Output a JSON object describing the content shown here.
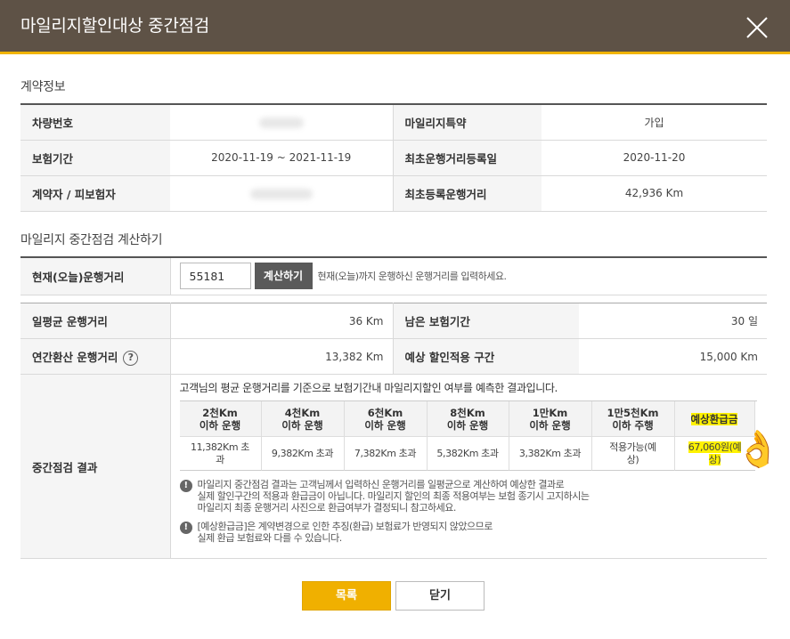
{
  "dialog": {
    "title": "마일리지할인대상 중간점검"
  },
  "contract": {
    "section_title": "계약정보",
    "vehicle_label": "차량번호",
    "mileage_special_label": "마일리지특약",
    "mileage_special_value": "가입",
    "period_label": "보험기간",
    "period_value": "2020-11-19 ~ 2021-11-19",
    "first_reg_date_label": "최초운행거리등록일",
    "first_reg_date_value": "2020-11-20",
    "holder_label": "계약자 / 피보험자",
    "first_reg_distance_label": "최초등록운행거리",
    "first_reg_distance_value": "42,936 Km"
  },
  "calc": {
    "section_title": "마일리지 중간점검 계산하기",
    "current_label": "현재(오늘)운행거리",
    "current_value": "55181",
    "calc_button": "계산하기",
    "hint": "현재(오늘)까지 운행하신 운행거리를 입력하세요.",
    "daily_avg_label": "일평균 운행거리",
    "daily_avg_value": "36 Km",
    "remaining_label": "남은 보험기간",
    "remaining_value": "30 일",
    "annual_label": "연간환산 운행거리",
    "help_icon_glyph": "?",
    "expected_label": "예상 할인적용 구간",
    "expected_value": "15,000 Km",
    "result_label": "중간점검 결과",
    "result_desc": "고객님의 평균 운행거리를 기준으로 보험기간내 마일리지할인 여부를 예측한 결과입니다.",
    "annual_value": "13,382 Km"
  },
  "result_table": {
    "headers": [
      [
        "2천Km",
        "이하 운행"
      ],
      [
        "4천Km",
        "이하 운행"
      ],
      [
        "6천Km",
        "이하 운행"
      ],
      [
        "8천Km",
        "이하 운행"
      ],
      [
        "1만Km",
        "이하 운행"
      ],
      [
        "1만5천Km",
        "이하 주행"
      ],
      [
        "예상환급금",
        ""
      ]
    ],
    "values": [
      [
        "11,382Km 초",
        "과"
      ],
      [
        "9,382Km 초과",
        ""
      ],
      [
        "7,382Km 초과",
        ""
      ],
      [
        "5,382Km 초과",
        ""
      ],
      [
        "3,382Km 초과",
        ""
      ],
      [
        "적용가능(예",
        "상)"
      ],
      [
        "67,060원(예",
        "상)"
      ]
    ]
  },
  "notes": [
    {
      "icon": "!",
      "lines": [
        "마일리지 중간점검 결과는 고객님께서 입력하신 운행거리를 일평균으로 계산하여 예상한 결과로",
        "실제 할인구간의 적용과 환급금이 아닙니다. 마일리지 할인의 최종 적용여부는 보험 종기시 고지하시는",
        "마일리지 최종 운행거리 사진으로 환급여부가 결정되니 참고하세요."
      ]
    },
    {
      "icon": "!",
      "lines": [
        "[예상환급금]은 계약변경으로 인한 추징(환급) 보험료가 반영되지 않았으므로",
        "실제 환급 보험료와 다를 수 있습니다."
      ]
    }
  ],
  "buttons": {
    "list": "목록",
    "close": "닫기"
  },
  "decor": {
    "ok_emoji": "👌"
  },
  "colors": {
    "header_bg": "#5e5246",
    "accent": "#f0b000",
    "highlight": "#fff200"
  }
}
